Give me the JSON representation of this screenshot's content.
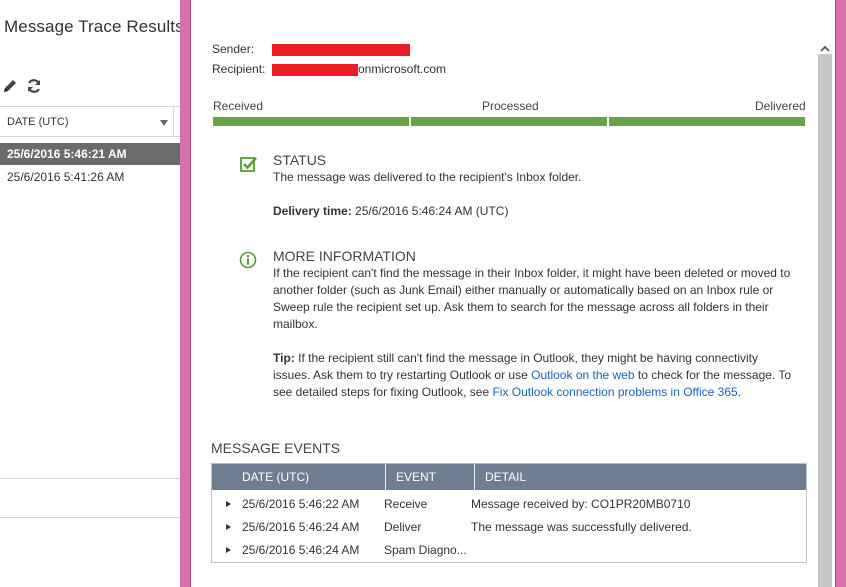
{
  "left_panel": {
    "title": "Message Trace Results",
    "toolbar": {
      "edit_icon": "pencil-icon",
      "refresh_icon": "refresh-icon"
    },
    "column_header": "DATE (UTC)",
    "rows": [
      {
        "date": "25/6/2016 5:46:21 AM",
        "selected": true
      },
      {
        "date": "25/6/2016 5:41:26 AM",
        "selected": false
      }
    ]
  },
  "detail": {
    "sender_label": "Sender:",
    "recipient_label": "Recipient:",
    "recipient_suffix": "onmicrosoft.com",
    "progress": {
      "steps": [
        "Received",
        "Processed",
        "Delivered"
      ],
      "completed": 3,
      "color": "#6aa33f"
    },
    "status": {
      "heading": "STATUS",
      "message": "The message was delivered to the recipient's Inbox folder.",
      "delivery_label": "Delivery time:",
      "delivery_value": "25/6/2016 5:46:24 AM (UTC)"
    },
    "more_info": {
      "heading": "MORE INFORMATION",
      "paragraph": "If the recipient can't find the message in their Inbox folder, it might have been deleted or moved to another folder (such as Junk Email) either manually or automatically based on an Inbox rule or Sweep rule the recipient set up. Ask them to search for the message across all folders in their mailbox.",
      "tip_label": "Tip:",
      "tip_text_1": "If the recipient still can't find the message in Outlook, they might be having connectivity issues. Ask them to try restarting Outlook or use",
      "tip_link_1": "Outlook on the web",
      "tip_text_2": "to check for the message. To see detailed steps for fixing Outlook, see",
      "tip_link_2": "Fix Outlook connection problems in Office 365",
      "tip_text_3": "."
    },
    "events": {
      "title": "MESSAGE EVENTS",
      "columns": [
        "DATE (UTC)",
        "EVENT",
        "DETAIL"
      ],
      "rows": [
        {
          "date": "25/6/2016 5:46:22 AM",
          "event": "Receive",
          "detail": "Message received by: CO1PR20MB0710"
        },
        {
          "date": "25/6/2016 5:46:24 AM",
          "event": "Deliver",
          "detail": "The message was successfully delivered."
        },
        {
          "date": "25/6/2016 5:46:24 AM",
          "event": "Spam Diagno...",
          "detail": ""
        }
      ]
    }
  },
  "colors": {
    "accent_pink": "#d870ac",
    "progress_green": "#6aa33f",
    "table_header": "#6f7f91",
    "link": "#1c63b7",
    "redaction": "#ec1c24"
  }
}
